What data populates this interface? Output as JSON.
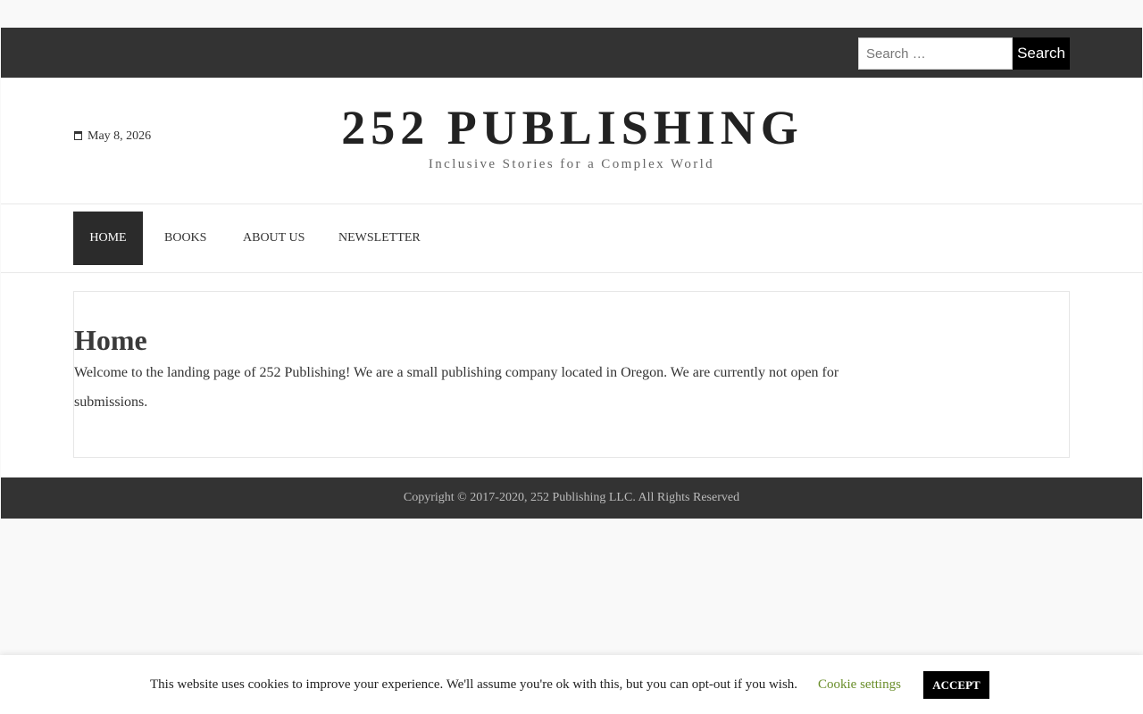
{
  "search": {
    "placeholder": "Search …",
    "button_label": "Search"
  },
  "header": {
    "date": "May 8, 2026",
    "site_title": "252 PUBLISHING",
    "tagline": "Inclusive Stories for a Complex World"
  },
  "nav": {
    "items": [
      {
        "label": "HOME",
        "active": true
      },
      {
        "label": "BOOKS",
        "active": false
      },
      {
        "label": "ABOUT US",
        "active": false
      },
      {
        "label": "NEWSLETTER",
        "active": false
      }
    ]
  },
  "main": {
    "title": "Home",
    "text": "Welcome to the landing page of 252 Publishing! We are a small publishing company located in Oregon. We are currently not open for submissions."
  },
  "footer": {
    "copyright": "Copyright © 2017-2020, 252 Publishing LLC. All Rights Reserved"
  },
  "cookie": {
    "message": "This website uses cookies to improve your experience. We'll assume you're ok with this, but you can opt-out if you wish.",
    "settings_label": "Cookie settings",
    "accept_label": "ACCEPT"
  },
  "colors": {
    "topbar": "#333333",
    "nav_active": "#2b2b2b",
    "cookie_link": "#6a8e2a"
  }
}
